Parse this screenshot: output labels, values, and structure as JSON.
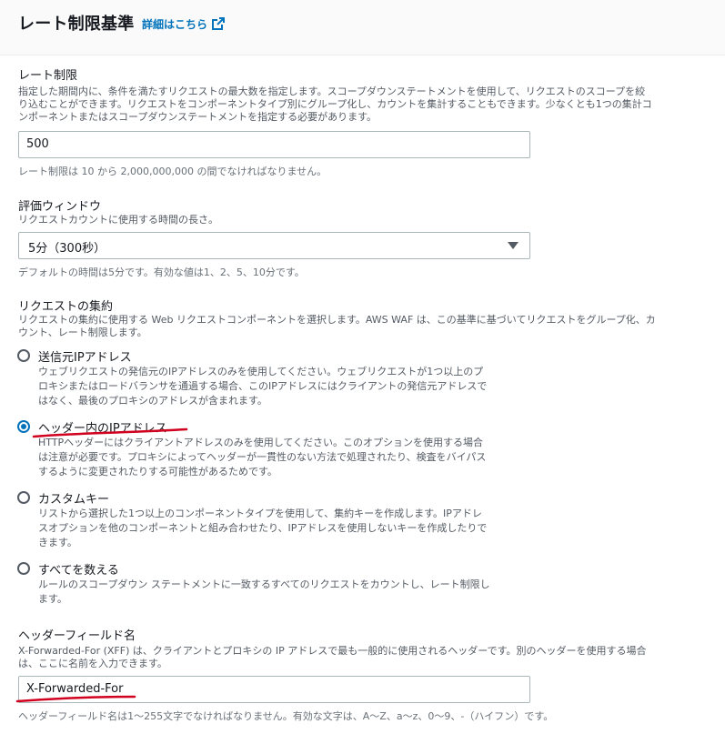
{
  "header": {
    "title": "レート制限基準",
    "info_link": "詳細はこちら",
    "info_icon": "external-link-icon"
  },
  "rate_limit": {
    "label": "レート制限",
    "description_lines": [
      "指定した期間内に、条件を満たすリクエストの最大数を指定します。スコープダウンステートメントを使用して、リクエストのスコープを絞",
      "り込むことができます。リクエストをコンポーネントタイプ別にグループ化し、カウントを集計することもできます。少なくとも1つの集計コ",
      "ンポーネントまたはスコープダウンステートメントを指定する必要があります。"
    ],
    "value": "500",
    "hint": "レート制限は 10 から 2,000,000,000 の間でなければなりません。"
  },
  "evaluation_window": {
    "label": "評価ウィンドウ",
    "description": "リクエストカウントに使用する時間の長さ。",
    "selected": "5分（300秒）",
    "hint": "デフォルトの時間は5分です。有効な値は1、2、5、10分です。"
  },
  "aggregation": {
    "label": "リクエストの集約",
    "description_lines": [
      "リクエストの集約に使用する Web リクエストコンポーネントを選択します。AWS WAF は、この基準に基づいてリクエストをグループ化、カ",
      "ウント、レート制限します。"
    ],
    "options": [
      {
        "label": "送信元IPアドレス",
        "checked": false,
        "description_lines": [
          "ウェブリクエストの発信元のIPアドレスのみを使用してください。ウェブリクエストが1つ以上のプ",
          "ロキシまたはロードバランサを通過する場合、このIPアドレスにはクライアントの発信元アドレスで",
          "はなく、最後のプロキシのアドレスが含まれます。"
        ]
      },
      {
        "label": "ヘッダー内のIPアドレス",
        "checked": true,
        "description_lines": [
          "HTTPヘッダーにはクライアントアドレスのみを使用してください。このオプションを使用する場合",
          "は注意が必要です。プロキシによってヘッダーが一貫性のない方法で処理されたり、検査をバイパス",
          "するように変更されたりする可能性があるためです。"
        ]
      },
      {
        "label": "カスタムキー",
        "checked": false,
        "description_lines": [
          "リストから選択した1つ以上のコンポーネントタイプを使用して、集約キーを作成します。IPアドレ",
          "スオプションを他のコンポーネントと組み合わせたり、IPアドレスを使用しないキーを作成したりで",
          "きます。"
        ]
      },
      {
        "label": "すべてを数える",
        "checked": false,
        "description_lines": [
          "ルールのスコープダウン ステートメントに一致するすべてのリクエストをカウントし、レート制限し",
          "ます。"
        ]
      }
    ]
  },
  "header_field": {
    "label": "ヘッダーフィールド名",
    "description_lines": [
      "X-Forwarded-For (XFF) は、クライアントとプロキシの IP アドレスで最も一般的に使用されるヘッダーです。別のヘッダーを使用する場合",
      "は、ここに名前を入力できます。"
    ],
    "value": "X-Forwarded-For",
    "hint": "ヘッダーフィールド名は1〜255文字でなければなりません。有効な文字は、A〜Z、a〜z、0〜9、-（ハイフン）です。"
  },
  "colors": {
    "link": "#0073bb",
    "radio_selected": "#0073bb",
    "annotation": "#d1001f"
  }
}
